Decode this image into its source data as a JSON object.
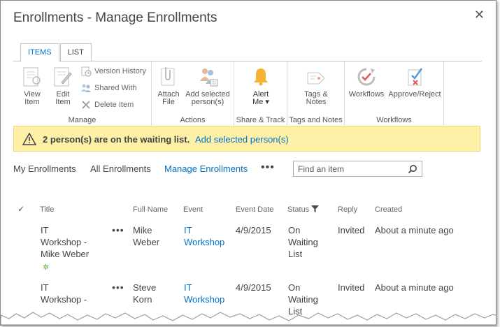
{
  "dialog": {
    "title": "Enrollments - Manage Enrollments",
    "close_glyph": "✕"
  },
  "ribbon": {
    "tabs": [
      {
        "label": "ITEMS",
        "active": true
      },
      {
        "label": "LIST",
        "active": false
      }
    ],
    "groups": {
      "manage": {
        "label": "Manage",
        "view_item_line1": "View",
        "view_item_line2": "Item",
        "edit_item_line1": "Edit",
        "edit_item_line2": "Item",
        "version_history": "Version History",
        "shared_with": "Shared With",
        "delete_item": "Delete Item"
      },
      "actions": {
        "label": "Actions",
        "attach_line1": "Attach",
        "attach_line2": "File",
        "add_selected_line1": "Add selected",
        "add_selected_line2": "person(s)"
      },
      "share_track": {
        "label": "Share & Track",
        "alert_line1": "Alert",
        "alert_line2": "Me ▾"
      },
      "tags_notes": {
        "label": "Tags and Notes",
        "tags_line1": "Tags &",
        "tags_line2": "Notes"
      },
      "workflows": {
        "label": "Workflows",
        "workflows_btn": "Workflows",
        "approve_btn": "Approve/Reject"
      }
    }
  },
  "banner": {
    "message": "2 person(s) are on the waiting list.",
    "link": "Add selected person(s)"
  },
  "views": {
    "items": [
      "My Enrollments",
      "All Enrollments",
      "Manage Enrollments"
    ],
    "active": "Manage Enrollments",
    "more": "•••"
  },
  "search": {
    "placeholder": "Find an item"
  },
  "table": {
    "check_glyph": "✓",
    "columns": [
      "Title",
      "Full Name",
      "Event",
      "Event Date",
      "Status",
      "Reply",
      "Created"
    ],
    "rows": [
      {
        "title_l1": "IT",
        "title_l2": "Workshop -",
        "title_l3": "Mike Weber",
        "new_glyph": "✲",
        "full_l1": "Mike",
        "full_l2": "Weber",
        "event_l1": "IT",
        "event_l2": "Workshop",
        "date": "4/9/2015",
        "status_l1": "On",
        "status_l2": "Waiting",
        "status_l3": "List",
        "reply": "Invited",
        "created": "About a minute ago"
      },
      {
        "title_l1": "IT",
        "title_l2": "Workshop -",
        "title_l3": "",
        "full_l1": "Steve",
        "full_l2": "Korn",
        "event_l1": "IT",
        "event_l2": "Workshop",
        "date": "4/9/2015",
        "status_l1": "On",
        "status_l2": "Waiting",
        "status_l3": "List",
        "reply": "Invited",
        "created": "About a minute ago"
      }
    ],
    "row_dots": "•••"
  },
  "colors": {
    "accent": "#0072c6",
    "banner_bg": "#fff0a8",
    "new_icon": "#6aa82f"
  }
}
